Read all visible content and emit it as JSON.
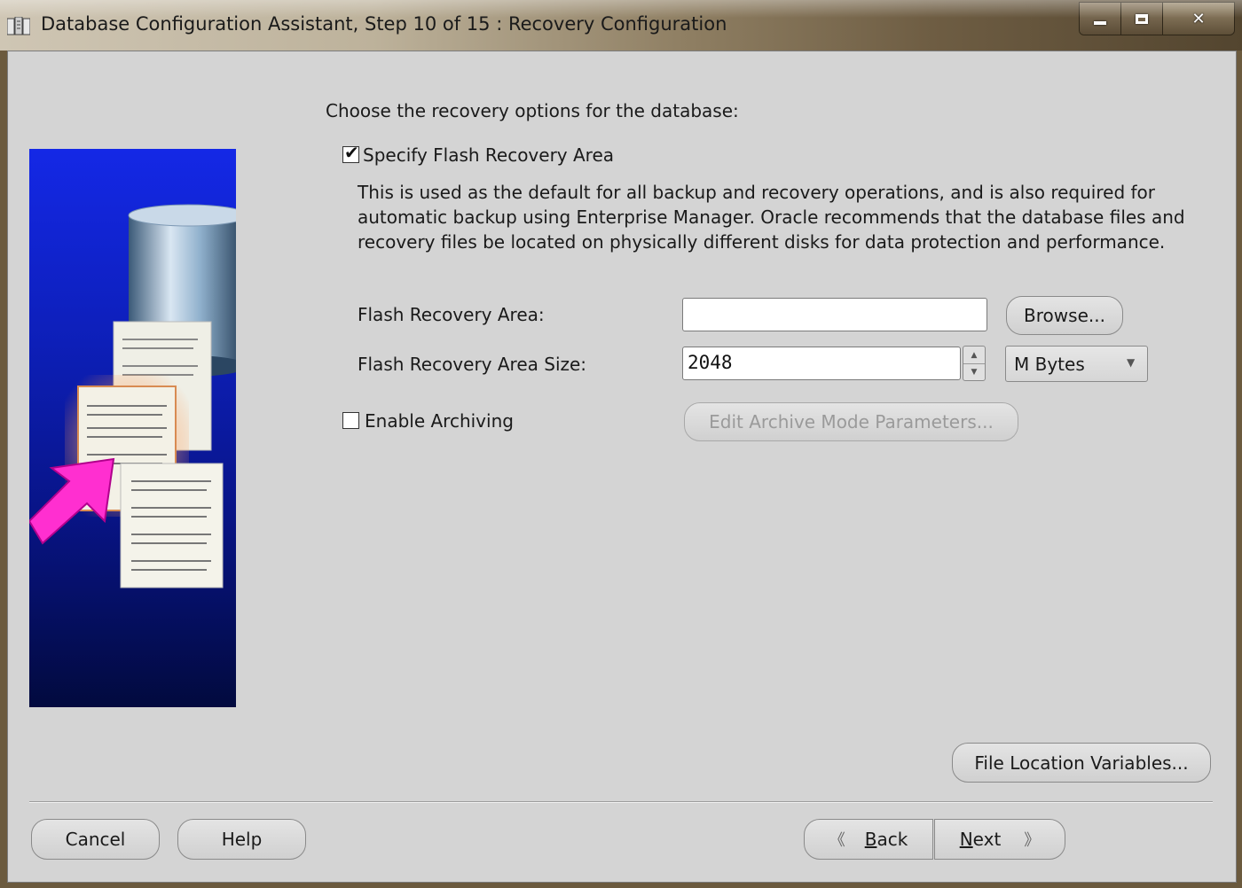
{
  "window": {
    "title": "Database Configuration Assistant, Step 10 of 15 : Recovery Configuration"
  },
  "content": {
    "intro": "Choose the recovery options for the database:",
    "specify_flash": {
      "label": "Specify Flash Recovery Area",
      "checked": true
    },
    "description": "This is used as the default for all backup and recovery operations, and is also required for automatic backup using Enterprise Manager. Oracle recommends that the database files and recovery files be located on physically different disks for data protection and performance.",
    "flash_area": {
      "label": "Flash Recovery Area:",
      "value": "",
      "browse_label": "Browse..."
    },
    "flash_size": {
      "label": "Flash Recovery Area Size:",
      "value": "2048",
      "unit": "M Bytes"
    },
    "archiving": {
      "label": "Enable Archiving",
      "checked": false,
      "edit_params_label": "Edit Archive Mode Parameters..."
    },
    "file_location_label": "File Location Variables..."
  },
  "footer": {
    "cancel_label": "Cancel",
    "help_label": "Help",
    "back_mnemonic": "B",
    "back_rest": "ack",
    "next_mnemonic": "N",
    "next_rest": "ext"
  }
}
